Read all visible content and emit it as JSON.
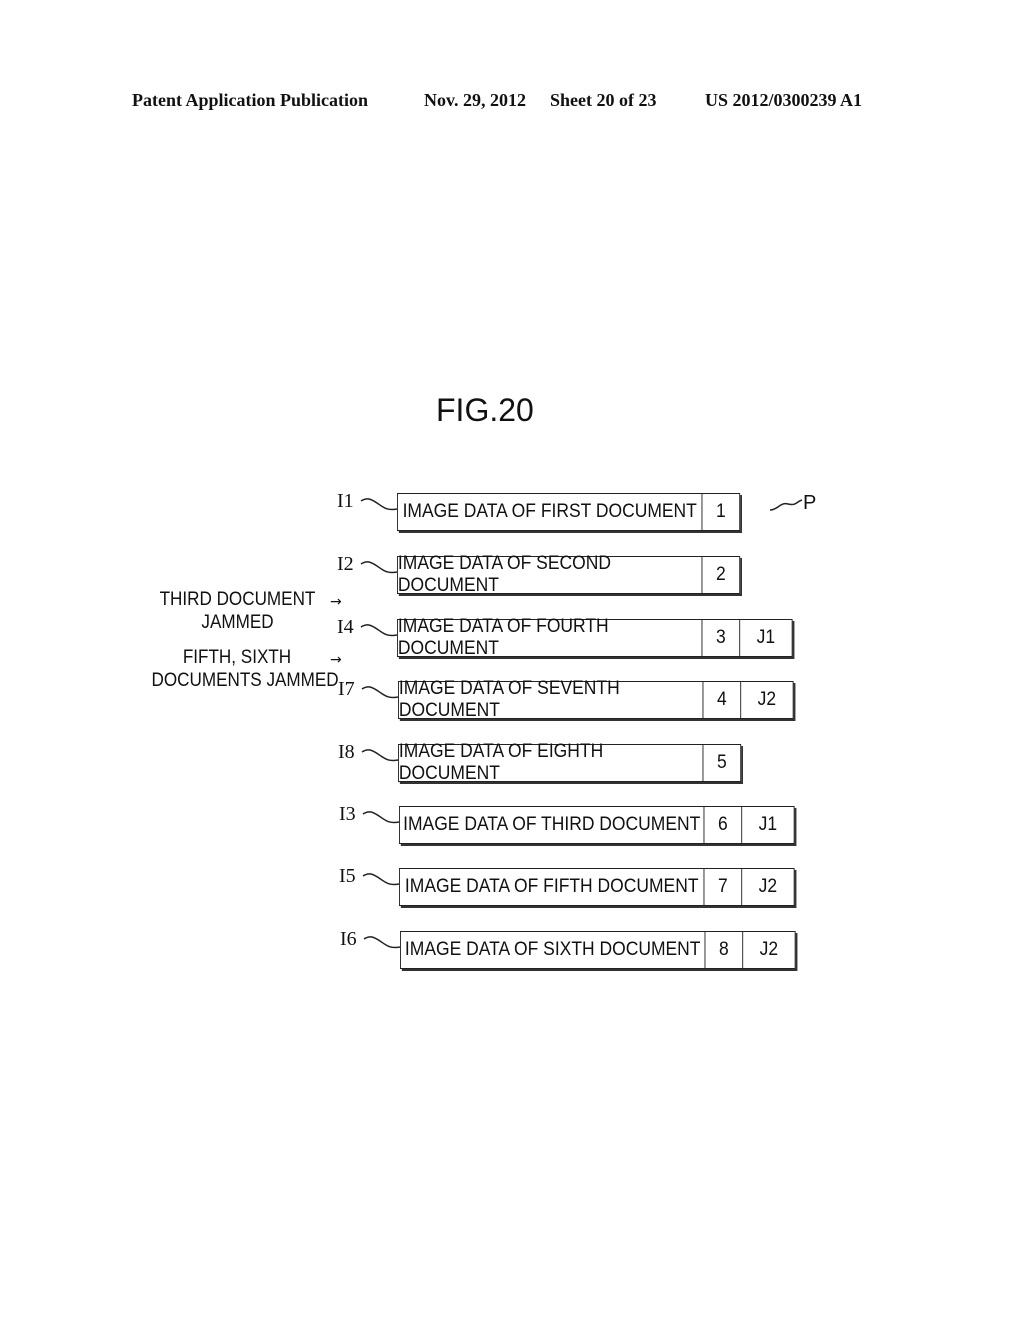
{
  "header": {
    "publication": "Patent Application Publication",
    "date": "Nov. 29, 2012",
    "sheet": "Sheet 20 of 23",
    "number": "US 2012/0300239 A1"
  },
  "figure": {
    "title": "FIG.20",
    "pointer_label": "P",
    "notes": [
      {
        "line1": "THIRD DOCUMENT",
        "line2": "JAMMED",
        "arrow": "→"
      },
      {
        "line1": "FIFTH, SIXTH",
        "line2": "DOCUMENTS JAMMED",
        "arrow": "→"
      }
    ],
    "records": [
      {
        "ref": "I1",
        "text": "IMAGE DATA OF FIRST DOCUMENT",
        "seq": "1",
        "jam": ""
      },
      {
        "ref": "I2",
        "text": "IMAGE DATA OF SECOND DOCUMENT",
        "seq": "2",
        "jam": ""
      },
      {
        "ref": "I4",
        "text": "IMAGE DATA OF FOURTH DOCUMENT",
        "seq": "3",
        "jam": "J1"
      },
      {
        "ref": "I7",
        "text": "IMAGE DATA OF SEVENTH DOCUMENT",
        "seq": "4",
        "jam": "J2"
      },
      {
        "ref": "I8",
        "text": "IMAGE DATA OF EIGHTH DOCUMENT",
        "seq": "5",
        "jam": ""
      },
      {
        "ref": "I3",
        "text": "IMAGE DATA OF THIRD DOCUMENT",
        "seq": "6",
        "jam": "J1"
      },
      {
        "ref": "I5",
        "text": "IMAGE DATA OF FIFTH DOCUMENT",
        "seq": "7",
        "jam": "J2"
      },
      {
        "ref": "I6",
        "text": "IMAGE DATA OF SIXTH DOCUMENT",
        "seq": "8",
        "jam": "J2"
      }
    ]
  }
}
